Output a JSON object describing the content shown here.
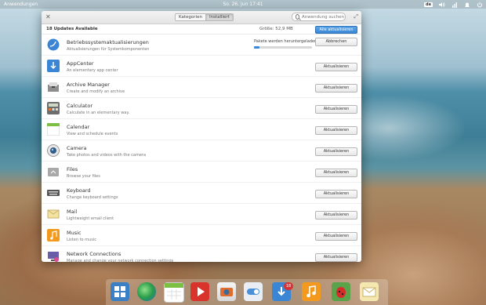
{
  "topbar": {
    "apps_label": "Anwendungen",
    "clock": "So. 26. Jun   17:41",
    "keyboard_layout": "de"
  },
  "window": {
    "tabs": [
      "Kategorien",
      "Installiert"
    ],
    "active_tab": "Installiert",
    "search_placeholder": "Anwendung suchen",
    "summary": {
      "count_label": "18 Updates Available",
      "size_label": "Größe: 52,9 MB",
      "update_all_label": "Alle aktualisieren"
    },
    "progress": {
      "label": "Pakete werden heruntergeladen",
      "fraction": 0.1,
      "cancel_label": "Abbrechen"
    },
    "update_label": "Aktualisieren",
    "rows": [
      {
        "name": "Betriebssystemaktualisierungen",
        "desc": "Aktualisierungen für Systemkomponenten",
        "icon": "os-updates-icon",
        "action": "Abbrechen"
      },
      {
        "name": "AppCenter",
        "desc": "An elementary app center",
        "icon": "appcenter-icon",
        "action": "Aktualisieren"
      },
      {
        "name": "Archive Manager",
        "desc": "Create and modify an archive",
        "icon": "archive-manager-icon",
        "action": "Aktualisieren"
      },
      {
        "name": "Calculator",
        "desc": "Calculate in an elementary way.",
        "icon": "calculator-icon",
        "action": "Aktualisieren"
      },
      {
        "name": "Calendar",
        "desc": "View and schedule events",
        "icon": "calendar-icon",
        "action": "Aktualisieren"
      },
      {
        "name": "Camera",
        "desc": "Take photos and videos with the camera",
        "icon": "camera-icon",
        "action": "Aktualisieren"
      },
      {
        "name": "Files",
        "desc": "Browse your files",
        "icon": "files-icon",
        "action": "Aktualisieren"
      },
      {
        "name": "Keyboard",
        "desc": "Change keyboard settings",
        "icon": "keyboard-icon",
        "action": "Aktualisieren"
      },
      {
        "name": "Mail",
        "desc": "Lightweight email client",
        "icon": "mail-icon",
        "action": "Aktualisieren"
      },
      {
        "name": "Music",
        "desc": "Listen to music",
        "icon": "music-icon",
        "action": "Aktualisieren"
      },
      {
        "name": "Network Connections",
        "desc": "Manage and change your network connection settings",
        "icon": "network-connections-icon",
        "action": "Aktualisieren"
      }
    ]
  },
  "dock": {
    "items": [
      "multitasking-icon",
      "browser-icon",
      "calendar-icon",
      "videos-icon",
      "photos-icon",
      "settings-icon",
      "appcenter-icon",
      "music-icon",
      "bug-icon",
      "mail-icon"
    ],
    "appcenter_badge": "18"
  },
  "colors": {
    "accent": "#3a86d4",
    "badge": "#d93232"
  }
}
